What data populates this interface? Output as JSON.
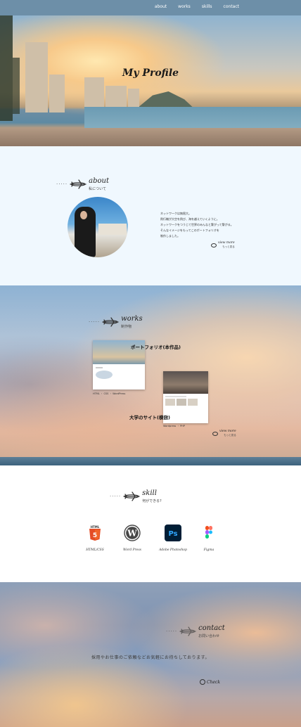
{
  "nav": {
    "links": [
      "about",
      "works",
      "skills",
      "contact"
    ],
    "background": "#6d8fa8"
  },
  "hero": {
    "title": "My Profile"
  },
  "about": {
    "title": "about",
    "subtitle": "私について",
    "text": [
      "ネットワークは無限大。",
      "飛行機が大空を飛び、海を越えていくように。",
      "ネットワークをつうじて世界のみんなと繋がって繋がる。",
      "そんなイメージをもってこのポートフォリオを",
      "制作しました。"
    ],
    "view_more": "view more",
    "view_more_sub": "もっと見る"
  },
  "works": {
    "title": "works",
    "subtitle": "制作物",
    "items": [
      {
        "title": "ポートフォリオ(本作品)",
        "tech": "HTML ・ CSS ・ WordPress"
      },
      {
        "title": "大学のサイト(模倣)",
        "tech": "Wordpress ・ PHP"
      }
    ],
    "view_more": "view more",
    "view_more_sub": "もっと見る"
  },
  "skill": {
    "title": "skill",
    "subtitle": "何ができる?",
    "items": [
      {
        "label": "HTML/CSS",
        "icon": "html5-icon",
        "badge": "HTML",
        "color": "#e44d26"
      },
      {
        "label": "Word Press",
        "icon": "wordpress-icon",
        "color": "#464646"
      },
      {
        "label": "Adobe Photoshop",
        "icon": "photoshop-icon",
        "badge": "Ps",
        "color": "#31a8ff"
      },
      {
        "label": "Figma",
        "icon": "figma-icon"
      }
    ]
  },
  "contact": {
    "title": "contact",
    "subtitle": "お問い合わせ",
    "message": "採用やお仕事のご依頼などお気軽にお待ちしております。",
    "check_label": "Check"
  }
}
